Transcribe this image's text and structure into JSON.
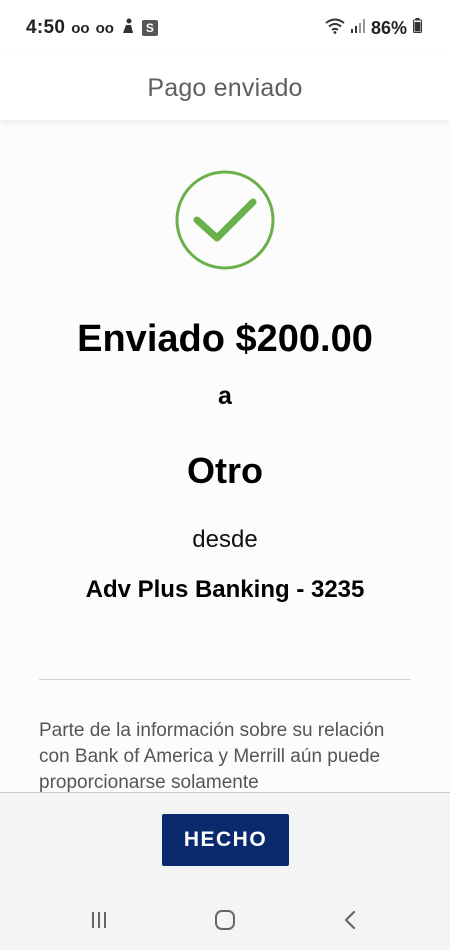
{
  "status_bar": {
    "time": "4:50",
    "voicemail_1": "oo",
    "voicemail_2": "oo",
    "s_badge": "S",
    "battery": "86%"
  },
  "header": {
    "title": "Pago enviado"
  },
  "confirmation": {
    "amount_text": "Enviado $200.00",
    "connector_to": "a",
    "recipient": "Otro",
    "connector_from": "desde",
    "account": "Adv Plus Banking - 3235",
    "success_color": "#6ab04c"
  },
  "disclaimer": {
    "text": "Parte de la información sobre su relación con Bank of America y Merrill aún puede proporcionarse solamente"
  },
  "footer": {
    "done_label": "HECHO",
    "button_color": "#0a2a6e"
  },
  "nav_bar": {
    "icons": [
      "recent-apps-icon",
      "home-icon",
      "back-icon"
    ]
  }
}
